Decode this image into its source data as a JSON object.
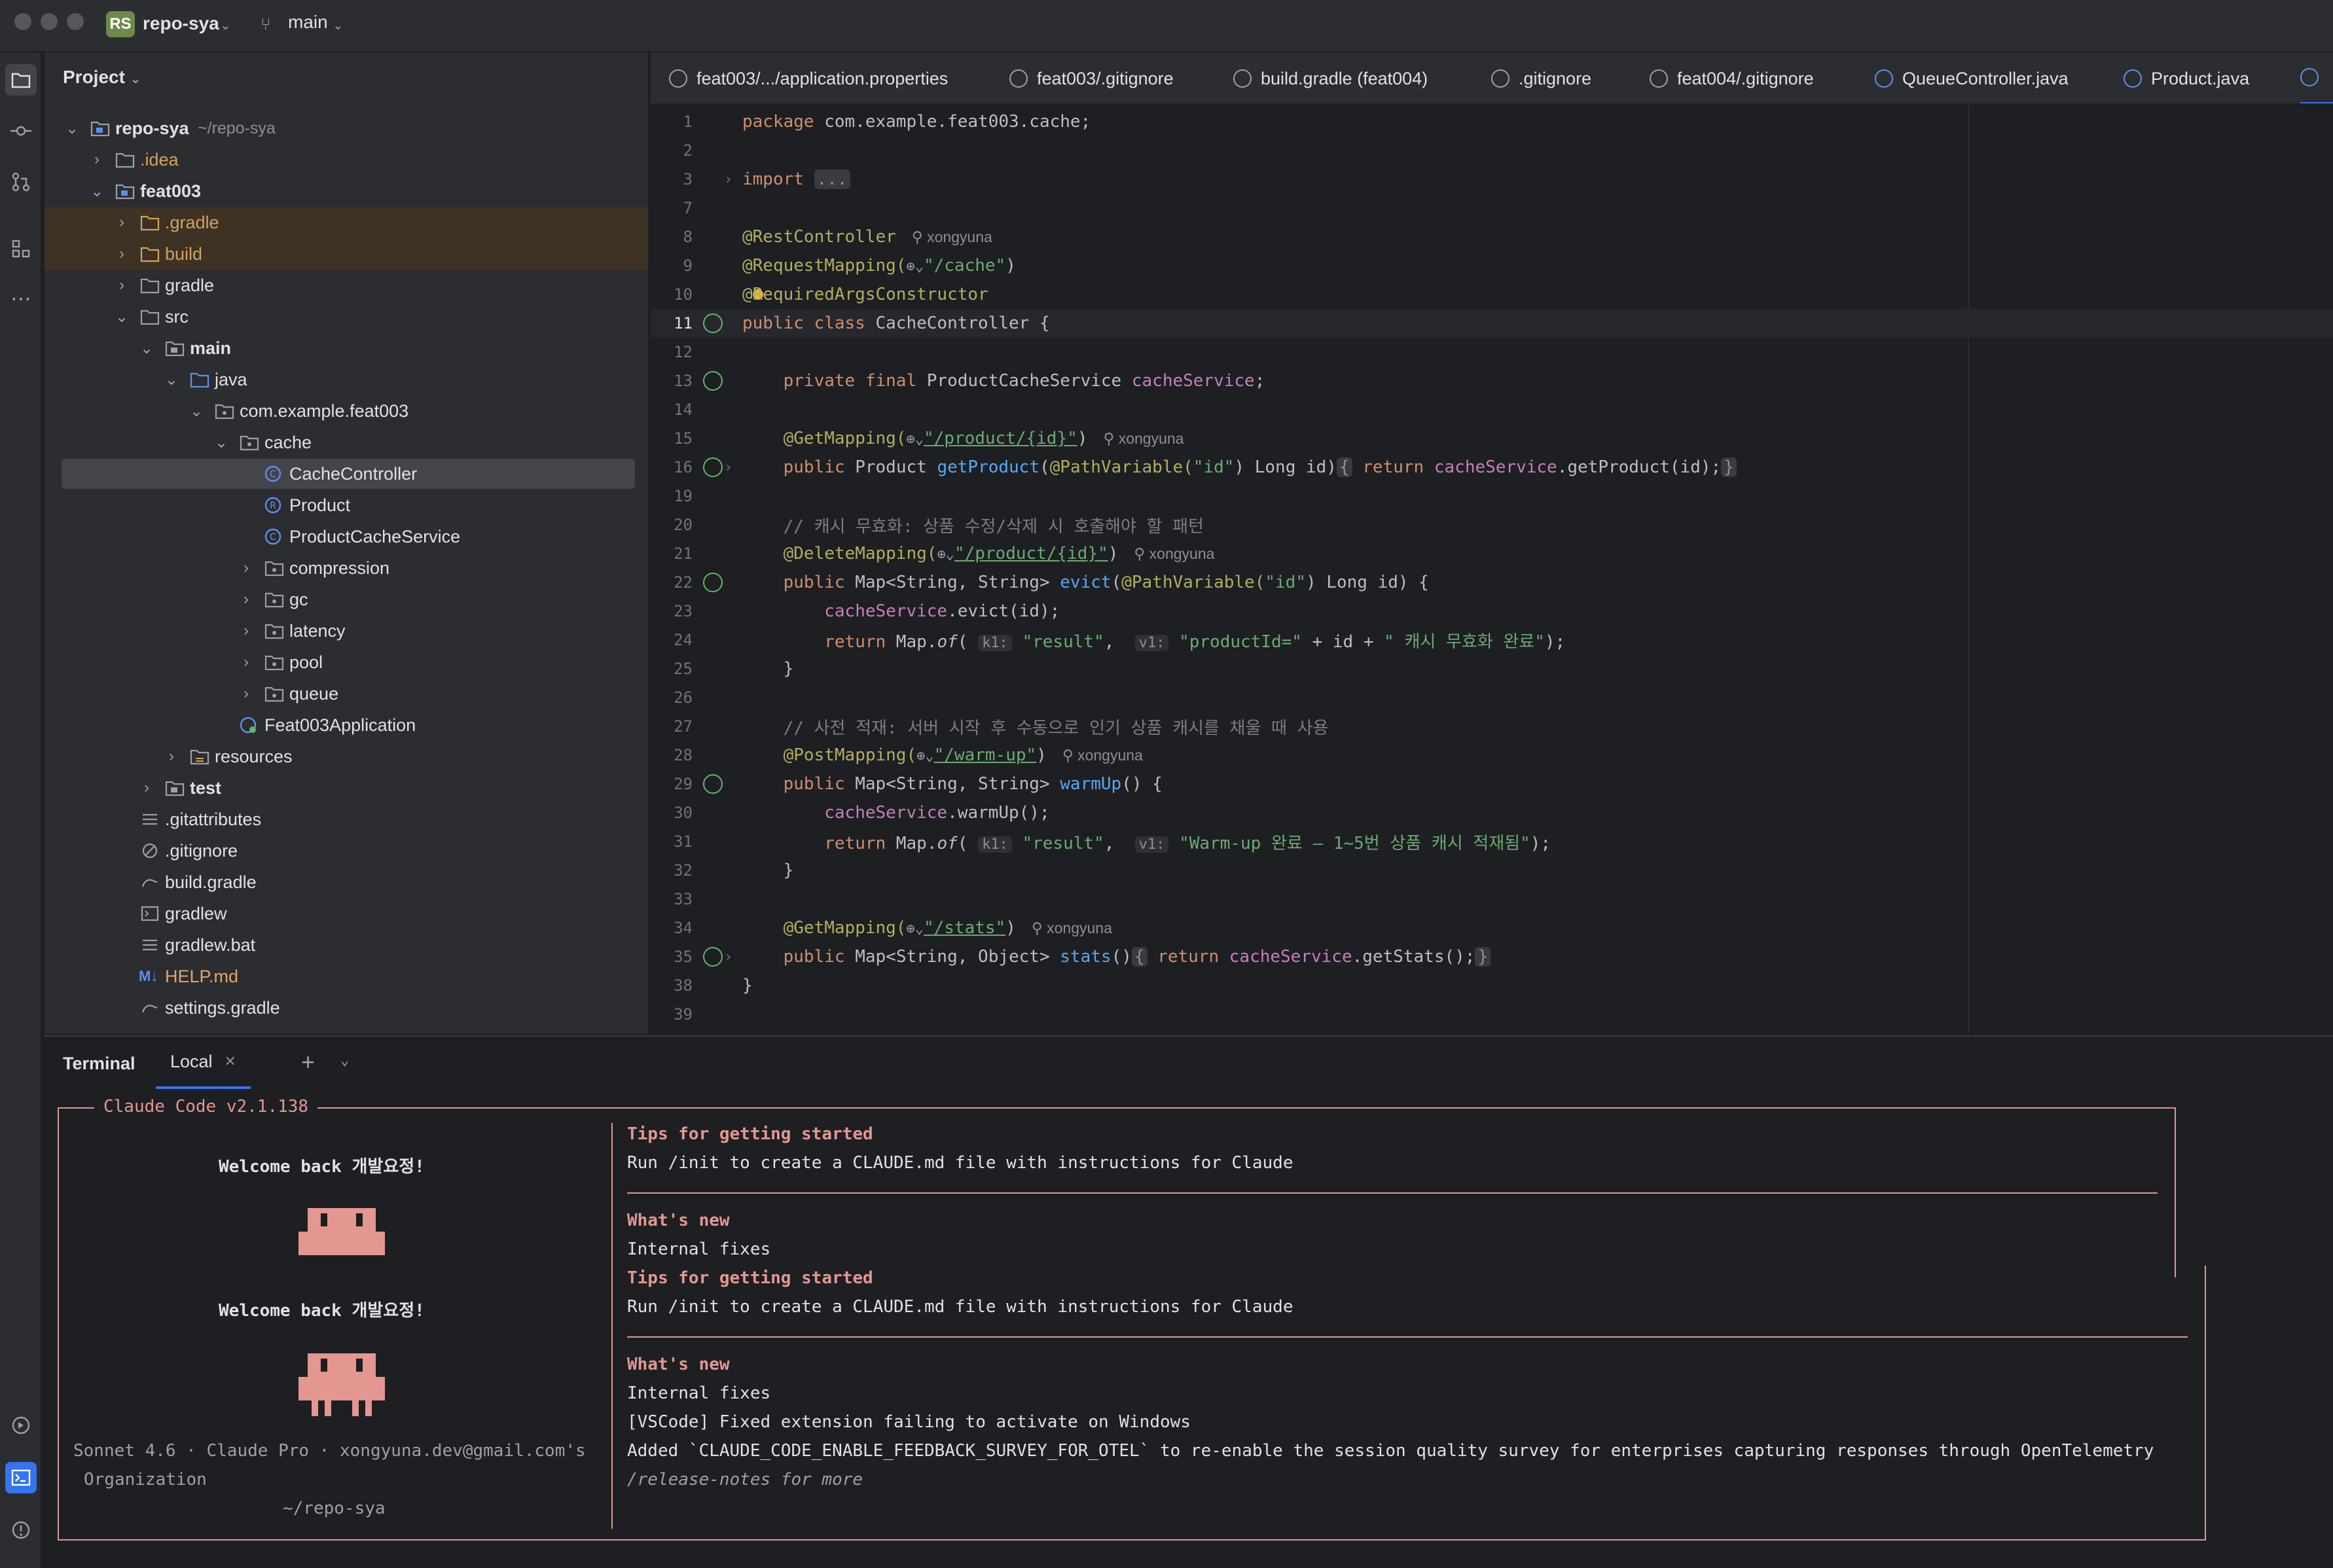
{
  "titlebar": {
    "badge": "RS",
    "project_name": "repo-sya",
    "branch": "main"
  },
  "project_panel": {
    "title": "Project",
    "tree": [
      {
        "label": "repo-sya",
        "sub": "~/repo-sya"
      },
      {
        "label": ".idea"
      },
      {
        "label": "feat003"
      },
      {
        "label": ".gradle"
      },
      {
        "label": "build"
      },
      {
        "label": "gradle"
      },
      {
        "label": "src"
      },
      {
        "label": "main"
      },
      {
        "label": "java"
      },
      {
        "label": "com.example.feat003"
      },
      {
        "label": "cache"
      },
      {
        "label": "CacheController"
      },
      {
        "label": "Product"
      },
      {
        "label": "ProductCacheService"
      },
      {
        "label": "compression"
      },
      {
        "label": "gc"
      },
      {
        "label": "latency"
      },
      {
        "label": "pool"
      },
      {
        "label": "queue"
      },
      {
        "label": "Feat003Application"
      },
      {
        "label": "resources"
      },
      {
        "label": "test"
      },
      {
        "label": ".gitattributes"
      },
      {
        "label": ".gitignore"
      },
      {
        "label": "build.gradle"
      },
      {
        "label": "gradlew"
      },
      {
        "label": "gradlew.bat"
      },
      {
        "label": "HELP.md"
      },
      {
        "label": "settings.gradle"
      }
    ]
  },
  "tabs": [
    "feat003/.../application.properties",
    "feat003/.gitignore",
    "build.gradle (feat004)",
    ".gitignore",
    "feat004/.gitignore",
    "QueueController.java",
    "Product.java"
  ],
  "editor": {
    "line_numbers": [
      "1",
      "2",
      "3",
      "7",
      "8",
      "9",
      "10",
      "11",
      "12",
      "13",
      "14",
      "15",
      "16",
      "19",
      "20",
      "21",
      "22",
      "23",
      "24",
      "25",
      "26",
      "27",
      "28",
      "29",
      "30",
      "31",
      "32",
      "33",
      "34",
      "35",
      "38",
      "39"
    ],
    "package_line": "com.example.feat003.cache;",
    "import_kw": "import",
    "import_fold": "...",
    "rest_controller": "@RestController",
    "author": "xongyuna",
    "request_mapping": "@RequestMapping(",
    "cache_path": "\"/cache\"",
    "required_args": "@RequiredArgsConstructor",
    "class_name": "CacheController",
    "field_type": "ProductCacheService",
    "field_name": "cacheService",
    "get_mapping": "@GetMapping(",
    "product_path": "\"/product/{id}\"",
    "get_product": "getProduct",
    "path_variable": "@PathVariable(",
    "id_str": "\"id\"",
    "comment_evict": "// 캐시 무효화: 상품 수정/삭제 시 호출해야 할 패턴",
    "delete_mapping": "@DeleteMapping(",
    "evict": "evict",
    "result_str": "\"result\"",
    "product_id_str": "\"productId=\"",
    "evict_msg": "\" 캐시 무효화 완료\"",
    "comment_warm": "// 사전 적재: 서버 시작 후 수동으로 인기 상품 캐시를 채울 때 사용",
    "post_mapping": "@PostMapping(",
    "warm_path": "\"/warm-up\"",
    "warm_up": "warmUp",
    "warm_msg": "\"Warm-up 완료 — 1~5번 상품 캐시 적재됨\"",
    "stats_path": "\"/stats\"",
    "stats": "stats",
    "get_stats": "getStats",
    "hint_k1": "k1:",
    "hint_v1": "v1:"
  },
  "terminal": {
    "title": "Terminal",
    "tab_label": "Local",
    "box_title": "Claude Code v2.1.138",
    "welcome": "Welcome back 개발요정!",
    "tips_heading": "Tips for getting started",
    "tips_body": "Run /init to create a CLAUDE.md file with instructions for Claude",
    "whats_new": "What's new",
    "internal_fixes": "Internal fixes",
    "vscode_fix": "[VSCode] Fixed extension failing to activate on Windows",
    "added_line": "Added `CLAUDE_CODE_ENABLE_FEEDBACK_SURVEY_FOR_OTEL` to re-enable the session quality survey for enterprises capturing responses through OpenTelemetry",
    "release_notes": "/release-notes for more",
    "account_line": "Sonnet 4.6 · Claude Pro · xongyuna.dev@gmail.com's",
    "org": "Organization",
    "cwd": "~/repo-sya"
  },
  "colors": {
    "accent": "#3574f0",
    "claude_border": "#e39790",
    "keyword": "#cf8e6d",
    "annotation": "#b3ae60",
    "string": "#6aab73",
    "field": "#c77dbb"
  }
}
